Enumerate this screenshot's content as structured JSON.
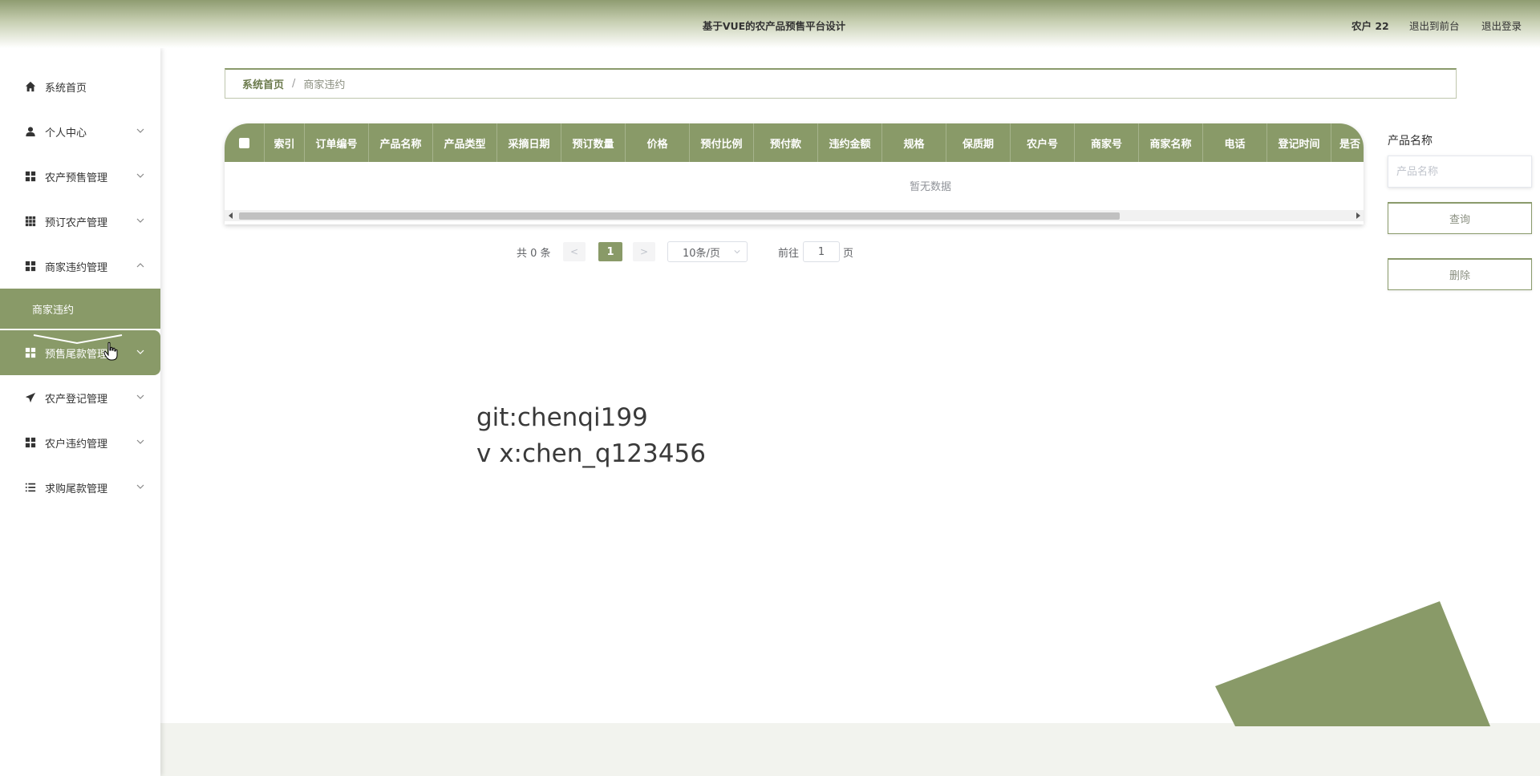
{
  "header": {
    "title": "基于VUE的农产品预售平台设计",
    "user": "农户 22",
    "to_front": "退出到前台",
    "logout": "退出登录"
  },
  "sidebar": {
    "items": [
      {
        "label": "系统首页",
        "icon": "home-icon"
      },
      {
        "label": "个人中心",
        "icon": "user-icon"
      },
      {
        "label": "农产预售管理",
        "icon": "grid-icon"
      },
      {
        "label": "预订农产管理",
        "icon": "grid-9-icon"
      },
      {
        "label": "商家违约管理",
        "icon": "grid-icon"
      },
      {
        "label": "预售尾款管理",
        "icon": "grid-icon"
      },
      {
        "label": "农产登记管理",
        "icon": "send-icon"
      },
      {
        "label": "农户违约管理",
        "icon": "grid-icon"
      },
      {
        "label": "求购尾款管理",
        "icon": "list-icon"
      }
    ],
    "submenu": "商家违约"
  },
  "breadcrumb": {
    "home": "系统首页",
    "sep": "/",
    "current": "商家违约"
  },
  "table": {
    "columns": [
      "索引",
      "订单编号",
      "产品名称",
      "产品类型",
      "采摘日期",
      "预订数量",
      "价格",
      "预付比例",
      "预付款",
      "违约金额",
      "规格",
      "保质期",
      "农户号",
      "商家号",
      "商家名称",
      "电话",
      "登记时间",
      "是否"
    ],
    "empty_text": "暂无数据"
  },
  "pagination": {
    "total": "共 0 条",
    "prev": "<",
    "current": "1",
    "next": ">",
    "page_size": "10条/页",
    "goto": "前往",
    "goto_value": "1",
    "page_unit": "页"
  },
  "search": {
    "label": "产品名称",
    "placeholder": "产品名称",
    "query": "查询",
    "delete": "删除"
  },
  "watermark": {
    "line1": "git:chenqi199",
    "line2": "v x:chen_q123456"
  },
  "colors": {
    "accent": "#899a68",
    "text": "#333333"
  }
}
